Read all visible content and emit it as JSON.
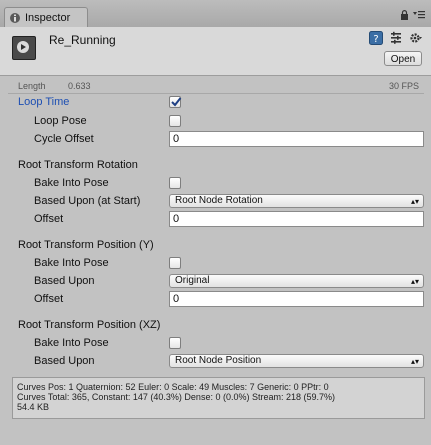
{
  "tab": {
    "title": "Inspector"
  },
  "clip": {
    "name": "Re_Running",
    "open_label": "Open"
  },
  "info": {
    "length_label": "Length",
    "length_value": "0.633",
    "fps": "30 FPS"
  },
  "loop_time": {
    "label": "Loop Time",
    "checked": true
  },
  "loop_pose": {
    "label": "Loop Pose",
    "checked": false
  },
  "cycle_offset": {
    "label": "Cycle Offset",
    "value": "0"
  },
  "rotation": {
    "title": "Root Transform Rotation",
    "bake_label": "Bake Into Pose",
    "based_label": "Based Upon (at Start)",
    "based_value": "Root Node Rotation",
    "offset_label": "Offset",
    "offset_value": "0"
  },
  "position_y": {
    "title": "Root Transform Position (Y)",
    "bake_label": "Bake Into Pose",
    "based_label": "Based Upon",
    "based_value": "Original",
    "offset_label": "Offset",
    "offset_value": "0"
  },
  "position_xz": {
    "title": "Root Transform Position (XZ)",
    "bake_label": "Bake Into Pose",
    "based_label": "Based Upon",
    "based_value": "Root Node Position"
  },
  "stats": {
    "line1": "Curves Pos: 1 Quaternion: 52 Euler: 0 Scale: 49 Muscles: 7 Generic: 0 PPtr: 0",
    "line2": "Curves Total: 365, Constant: 147 (40.3%) Dense: 0 (0.0%) Stream: 218 (59.7%)",
    "line3": "54.4 KB"
  }
}
